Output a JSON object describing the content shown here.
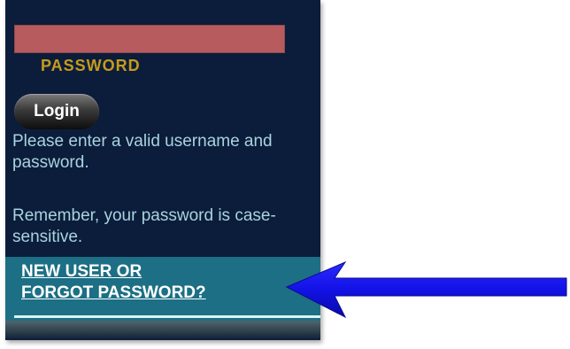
{
  "login_panel": {
    "password_field": {
      "value": "",
      "placeholder": ""
    },
    "password_label": "PASSWORD",
    "login_button_label": "Login",
    "error_message": "Please enter a valid username and password.",
    "case_note": "Remember, your password is case-sensitive.",
    "new_user_link_line1": "NEW USER OR",
    "new_user_link_line2": "FORGOT PASSWORD?"
  },
  "colors": {
    "panel_background": "#0b1d3a",
    "password_field": "#b85b5e",
    "label_gold": "#c79a1d",
    "message_text": "#a9d3df",
    "link_bar": "#1c6f84",
    "arrow": "#1212e6"
  },
  "icons": {
    "callout": "arrow-left-icon"
  }
}
